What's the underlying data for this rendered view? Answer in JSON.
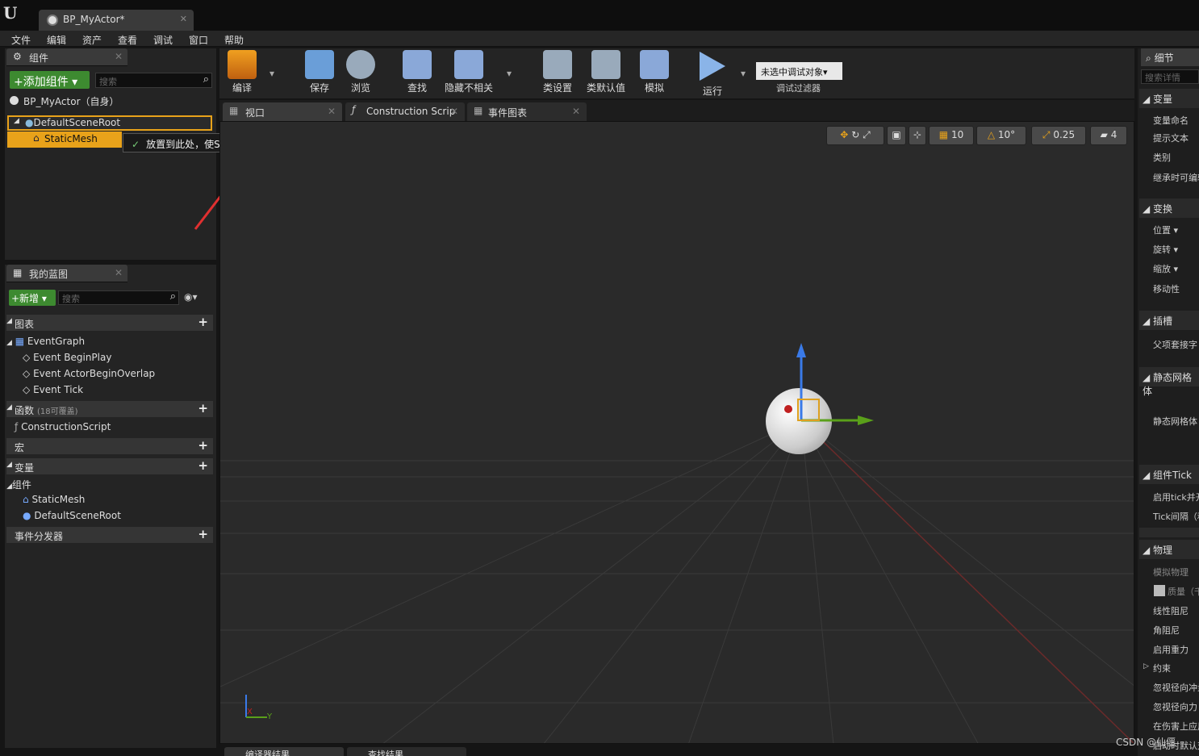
{
  "window": {
    "tab_title": "BP_MyActor*"
  },
  "menu": [
    "文件",
    "编辑",
    "资产",
    "查看",
    "调试",
    "窗口",
    "帮助"
  ],
  "components_panel": {
    "title": "组件",
    "add_button": "+添加组件",
    "search_placeholder": "搜索",
    "self_label": "BP_MyActor（自身）",
    "root": "DefaultSceneRoot",
    "child": "StaticMesh",
    "tooltip": "放置到此处，使StaticMesh成为新的根。默认的根将被删除。"
  },
  "myblueprint_panel": {
    "title": "我的蓝图",
    "new_button": "+新增",
    "search_placeholder": "搜索",
    "sections": {
      "graphs": "图表",
      "functions": "函数",
      "functions_note": "(18可覆盖)",
      "macros": "宏",
      "variables": "变量",
      "components": "组件",
      "dispatchers": "事件分发器"
    },
    "event_graph": "EventGraph",
    "events": [
      "Event BeginPlay",
      "Event ActorBeginOverlap",
      "Event Tick"
    ],
    "construction": "ConstructionScript",
    "components": [
      "StaticMesh",
      "DefaultSceneRoot"
    ]
  },
  "toolbar": {
    "compile": "编译",
    "save": "保存",
    "browse": "浏览",
    "find": "查找",
    "hide_unrelated": "隐藏不相关",
    "class_settings": "类设置",
    "class_defaults": "类默认值",
    "simulate": "模拟",
    "play": "运行",
    "debug_object": "未选中调试对象▾",
    "debug_filter": "调试过滤器"
  },
  "editor_tabs": [
    "视口",
    "Construction Scrip",
    "事件图表"
  ],
  "viewport": {
    "grid_snap": "10",
    "rot_snap": "10°",
    "scale_snap": "0.25",
    "cam_speed": "4",
    "axis_y": "Y",
    "axis_x": "X"
  },
  "bottom_tabs": [
    "编译器结果",
    "查找结果"
  ],
  "details": {
    "title": "细节",
    "search_placeholder": "搜索详情",
    "sections": [
      "变量",
      "变换",
      "插槽",
      "静态网格体",
      "组件Tick",
      "物理"
    ],
    "variable_props": [
      "变量命名",
      "提示文本",
      "类别",
      "继承时可编辑"
    ],
    "transform_props": [
      "位置 ▾",
      "旋转 ▾",
      "缩放 ▾",
      "移动性"
    ],
    "socket_props": [
      "父项套接字"
    ],
    "mesh_props": [
      "静态网格体"
    ],
    "tick_props": [
      "启用tick并开始",
      "Tick间隔（秒）"
    ],
    "physics_props": [
      "模拟物理",
      "质量（千克）",
      "线性阻尼",
      "角阻尼",
      "启用重力",
      "约束",
      "忽视径向冲量",
      "忽视径向力",
      "在伤害上应用",
      "启动时默认对象"
    ]
  },
  "watermark": "CSDN @仙僵"
}
